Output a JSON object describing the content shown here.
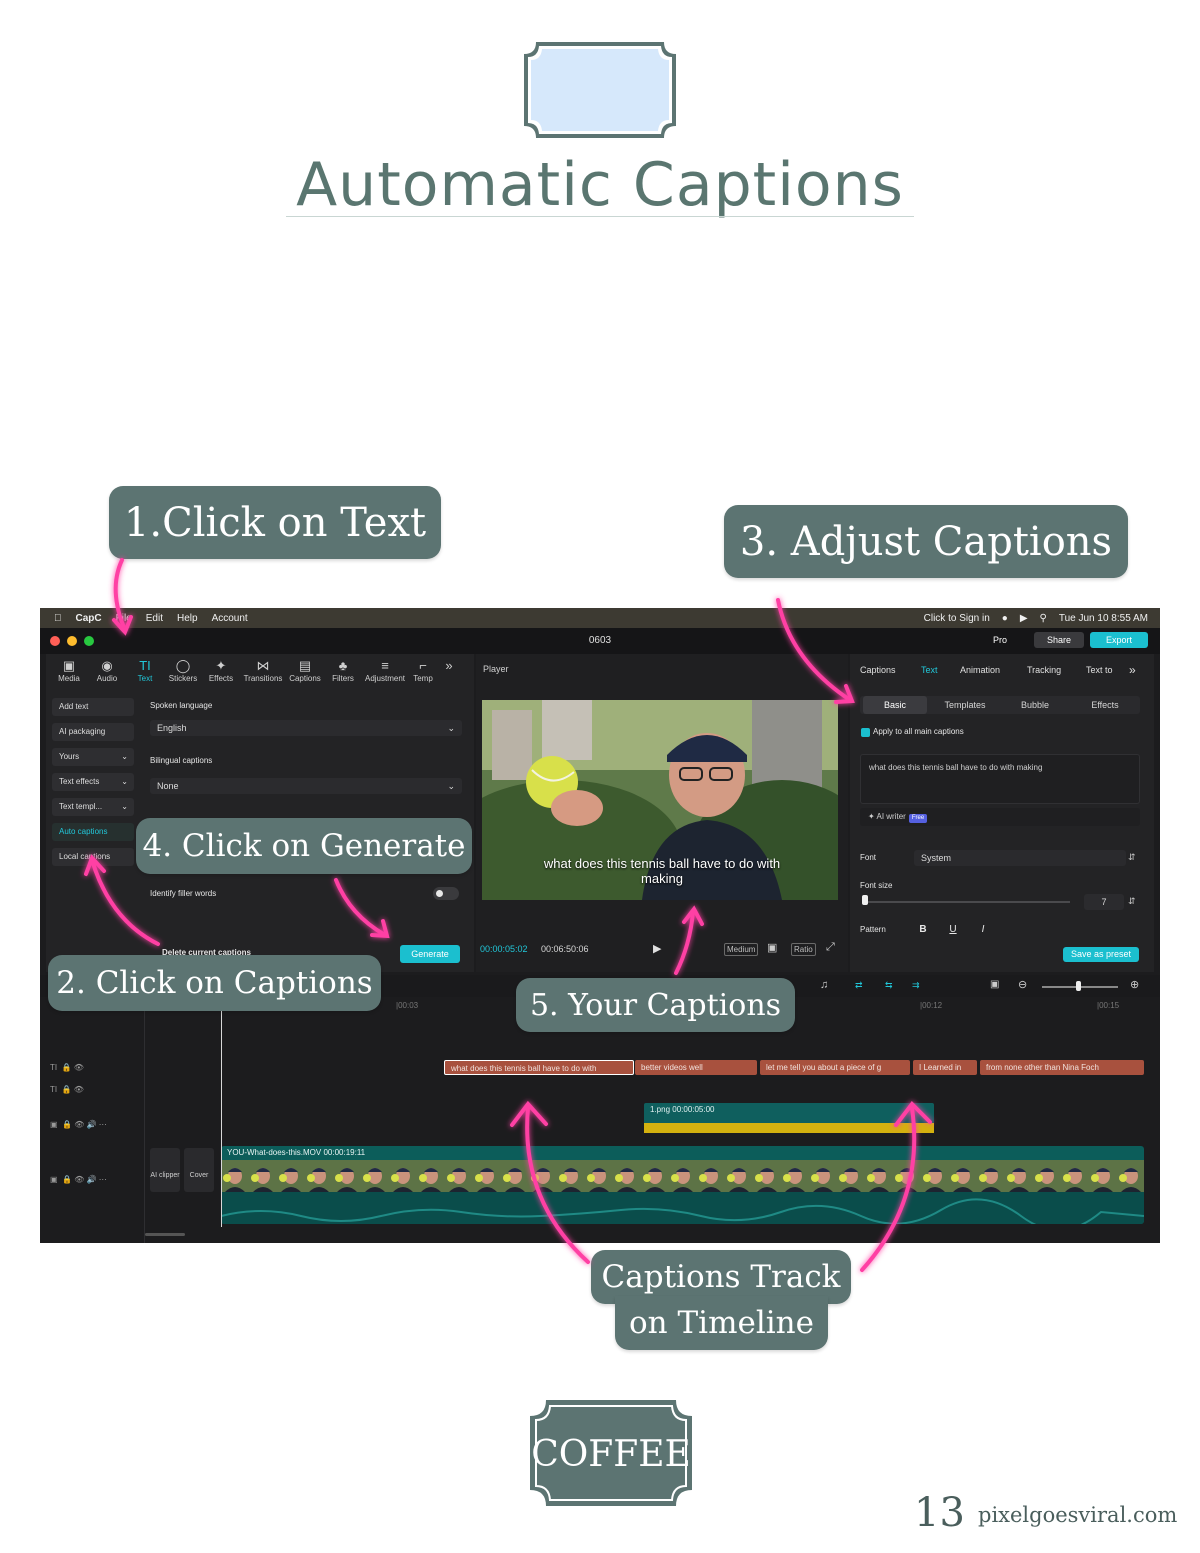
{
  "page": {
    "title": "Automatic Captions",
    "page_number": "13",
    "site": "pixelgoesviral.com",
    "badge_text": "COFFEE"
  },
  "callouts": {
    "step1": "1.Click on Text",
    "step2": "2. Click on Captions",
    "step3": "3. Adjust Captions",
    "step4": "4. Click on Generate",
    "step5": "5. Your Captions",
    "track_line1": "Captions Track",
    "track_line2": "on Timeline"
  },
  "colors": {
    "callout_bg": "#5c7472",
    "title": "#5a7670",
    "arrow": "#ff3fa4",
    "accent": "#22c7d9"
  },
  "app": {
    "menubar": {
      "app_name": "CapC",
      "items": [
        "File",
        "Edit",
        "Help",
        "Account"
      ],
      "sign_in": "Click to Sign in",
      "datetime": "Tue Jun 10  8:55 AM"
    },
    "window_title": "0603",
    "buttons": {
      "pro": "Pro",
      "share": "Share",
      "export": "Export"
    },
    "toolbar_tabs": [
      {
        "label": "Media",
        "icon": "media-icon"
      },
      {
        "label": "Audio",
        "icon": "audio-icon"
      },
      {
        "label": "Text",
        "icon": "text-icon"
      },
      {
        "label": "Stickers",
        "icon": "stickers-icon"
      },
      {
        "label": "Effects",
        "icon": "effects-icon"
      },
      {
        "label": "Transitions",
        "icon": "transitions-icon"
      },
      {
        "label": "Captions",
        "icon": "captions-icon"
      },
      {
        "label": "Filters",
        "icon": "filters-icon"
      },
      {
        "label": "Adjustment",
        "icon": "adjustment-icon"
      },
      {
        "label": "Temp",
        "icon": "template-icon"
      }
    ],
    "side_list": [
      "Add text",
      "AI packaging",
      "Yours",
      "Text effects",
      "Text templ...",
      "Auto captions",
      "Local captions"
    ],
    "captions_panel": {
      "spoken_language_label": "Spoken language",
      "spoken_language_value": "English",
      "bilingual_label": "Bilingual captions",
      "bilingual_value": "None",
      "filler_label": "Identify filler words",
      "delete_label": "Delete current captions",
      "generate": "Generate"
    },
    "player": {
      "label": "Player",
      "caption": "what does this tennis ball have to do with making",
      "current_time": "00:00:05:02",
      "total_time": "00:06:50:06",
      "quality": "Medium",
      "ratio": "Ratio"
    },
    "right_panel": {
      "tabs": [
        "Captions",
        "Text",
        "Animation",
        "Tracking",
        "Text to"
      ],
      "sub_tabs": [
        "Basic",
        "Templates",
        "Bubble",
        "Effects"
      ],
      "apply_all": "Apply to all main captions",
      "text_value": "what does this tennis ball have to do with making",
      "ai_writer": "AI writer",
      "free": "Free",
      "font_label": "Font",
      "font_value": "System",
      "font_size_label": "Font size",
      "font_size_value": "7",
      "pattern_label": "Pattern",
      "save_preset": "Save as preset"
    },
    "timeline": {
      "ticks": [
        "|00:03",
        "|00:12",
        "|00:15"
      ],
      "captions": [
        "what does this tennis ball have to do with",
        "better videos well",
        "let me tell you about a piece of g",
        "I Learned in",
        "from none other than Nina Foch"
      ],
      "image_clip": "1.png  00:00:05:00",
      "main_clip": "YOU-What-does-this.MOV  00:00:19:11",
      "ai_clipper": "AI clipper",
      "cover": "Cover"
    }
  }
}
